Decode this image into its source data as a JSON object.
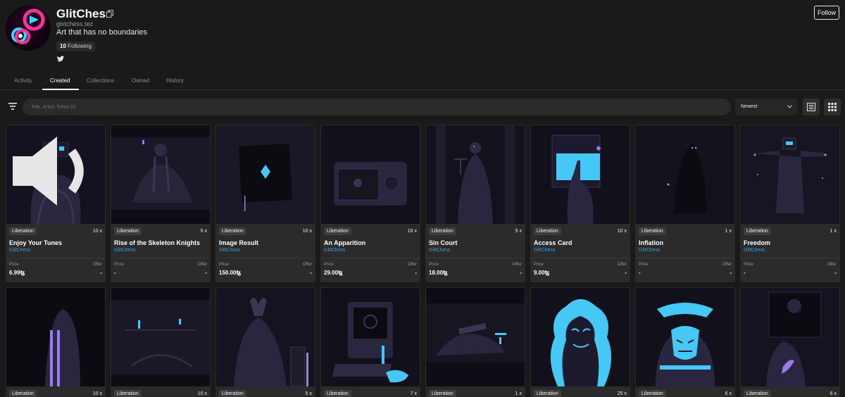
{
  "profile": {
    "name": "GlitChess",
    "handle": "glxtchess.tez",
    "bio": "Art that has no boundaries",
    "following_count": "10",
    "following_label": "Following",
    "follow_label": "Follow"
  },
  "tabs": [
    "Activity",
    "Created",
    "Collections",
    "Owned",
    "History"
  ],
  "active_tab": "Created",
  "search": {
    "placeholder": "Title, Artist, Token ID"
  },
  "sort": {
    "selected": "Newest"
  },
  "icons": [
    "copy-icon",
    "twitter-icon",
    "filter-icon",
    "chevron-down-icon",
    "list-view-icon",
    "grid-view-icon",
    "sound-icon"
  ],
  "colors": {
    "background": "#1a1a1a",
    "card": "#2b2b2b",
    "artist_link": "#3aa0e6",
    "accent_cyan": "#45c8f5",
    "accent_purple": "#9a7cf2"
  },
  "cards_row1": [
    {
      "badge": "Liberation",
      "editions": "10 x",
      "title": "Enjoy Your Tunes",
      "artist": "GlitChess",
      "price_label": "Price",
      "offer_label": "Offer",
      "price": "6.99ꜩ",
      "offer": "-"
    },
    {
      "badge": "Liberation",
      "editions": "5 x",
      "title": "Rise of the Skeleton Knights",
      "artist": "GlitChess",
      "price_label": "Price",
      "offer_label": "Offer",
      "price": "-",
      "offer": "-"
    },
    {
      "badge": "Liberation",
      "editions": "10 x",
      "title": "Image Result",
      "artist": "GlitChess",
      "price_label": "Price",
      "offer_label": "Offer",
      "price": "150.00ꜩ",
      "offer": "-"
    },
    {
      "badge": "Liberation",
      "editions": "10 x",
      "title": "An Apparition",
      "artist": "GlitChess",
      "price_label": "Price",
      "offer_label": "Offer",
      "price": "29.00ꜩ",
      "offer": "-"
    },
    {
      "badge": "Liberation",
      "editions": "5 x",
      "title": "Sin Court",
      "artist": "GlitChess",
      "price_label": "Price",
      "offer_label": "Offer",
      "price": "18.00ꜩ",
      "offer": "-"
    },
    {
      "badge": "Liberation",
      "editions": "10 x",
      "title": "Access Card",
      "artist": "GlitChess",
      "price_label": "Price",
      "offer_label": "Offer",
      "price": "9.00ꜩ",
      "offer": "-"
    },
    {
      "badge": "Liberation",
      "editions": "1 x",
      "title": "Inflation",
      "artist": "GlitChess",
      "price_label": "Price",
      "offer_label": "Offer",
      "price": "-",
      "offer": "-"
    },
    {
      "badge": "Liberation",
      "editions": "1 x",
      "title": "Freedom",
      "artist": "GlitChess",
      "price_label": "Price",
      "offer_label": "Offer",
      "price": "-",
      "offer": "-"
    }
  ],
  "cards_row2": [
    {
      "badge": "Liberation",
      "editions": "10 x"
    },
    {
      "badge": "Liberation",
      "editions": "10 x"
    },
    {
      "badge": "Liberation",
      "editions": "5 x"
    },
    {
      "badge": "Liberation",
      "editions": "7 x"
    },
    {
      "badge": "Liberation",
      "editions": "1 x"
    },
    {
      "badge": "Liberation",
      "editions": "25 x"
    },
    {
      "badge": "Liberation",
      "editions": "6 x"
    },
    {
      "badge": "Liberation",
      "editions": "6 x"
    }
  ]
}
